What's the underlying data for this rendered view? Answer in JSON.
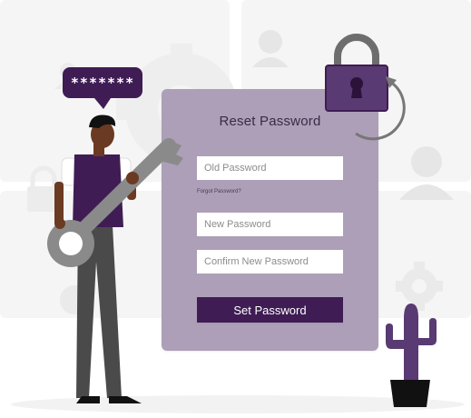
{
  "speech_bubble": {
    "text": "*******"
  },
  "form": {
    "title": "Reset Password",
    "old_password_placeholder": "Old Password",
    "forgot_link": "Forgot Password?",
    "new_password_placeholder": "New Password",
    "confirm_password_placeholder": "Confirm New Password",
    "submit_label": "Set Password"
  },
  "icons": [
    "lock-icon",
    "refresh-arrow-icon",
    "user-icon",
    "gear-icon",
    "key-icon",
    "cactus-icon"
  ],
  "colors": {
    "card": "#ad9fb7",
    "primary": "#3f1d54",
    "background_shapes": "#f5f5f5",
    "key": "#8a8a8a"
  }
}
